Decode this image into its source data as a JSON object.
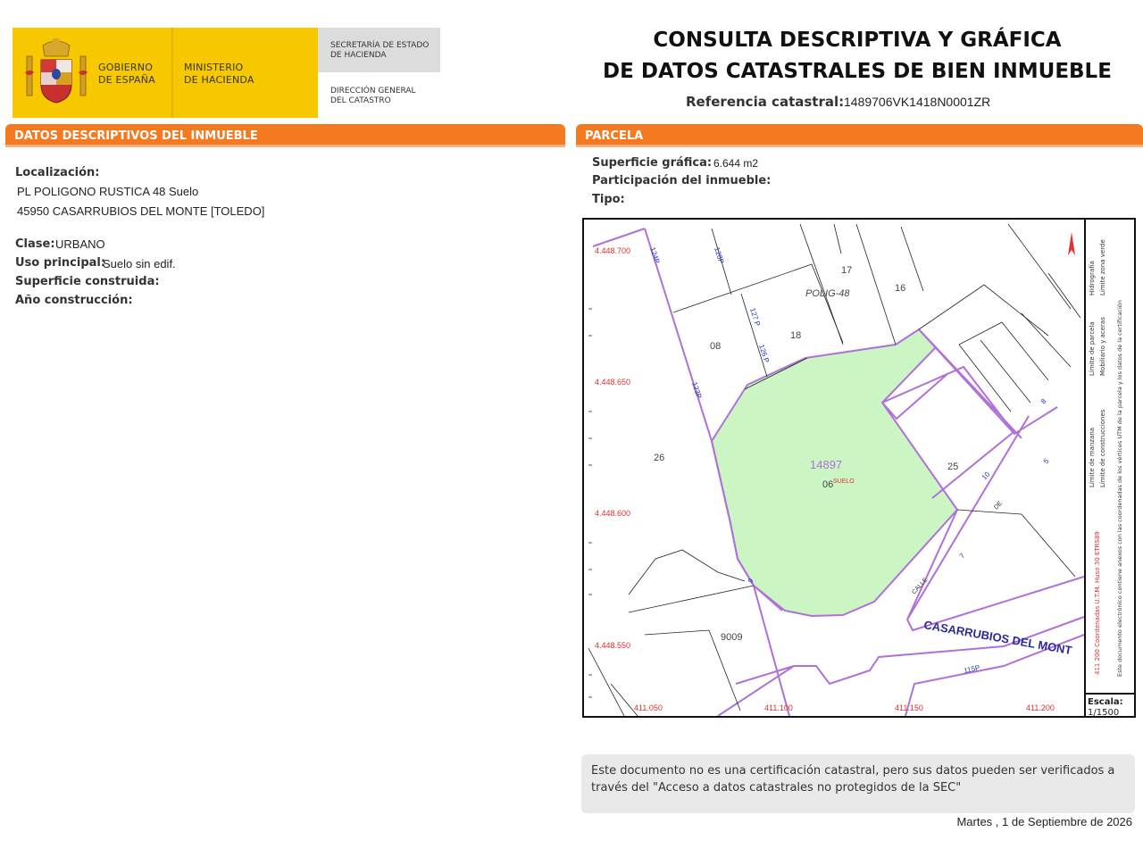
{
  "header": {
    "gobierno": [
      "GOBIERNO",
      "DE ESPAÑA"
    ],
    "ministerio": [
      "MINISTERIO",
      "DE HACIENDA"
    ],
    "secretaria": [
      "SECRETARÍA DE ESTADO",
      "DE HACIENDA"
    ],
    "direccion": [
      "DIRECCIÓN GENERAL",
      "DEL CATASTRO"
    ],
    "title_line1": "CONSULTA DESCRIPTIVA Y GRÁFICA",
    "title_line2": "DE DATOS CATASTRALES DE BIEN INMUEBLE",
    "ref_label": "Referencia catastral:",
    "ref_value": "1489706VK1418N0001ZR"
  },
  "datos": {
    "section_title": "DATOS DESCRIPTIVOS DEL INMUEBLE",
    "localizacion_label": "Localización:",
    "localizacion_line1": "PL POLIGONO RUSTICA 48  Suelo",
    "localizacion_line2": "45950 CASARRUBIOS DEL MONTE [TOLEDO]",
    "clase_label": "Clase:",
    "clase_value": "URBANO",
    "uso_label": "Uso principal:",
    "uso_value": "Suelo sin edif.",
    "superficie_label": "Superficie construida:",
    "anio_label": "Año construcción:"
  },
  "parcela": {
    "section_title": "PARCELA",
    "superficie_label": "Superficie gráfica:",
    "superficie_value": "6.644 m2",
    "participacion_label": "Participación del inmueble:",
    "tipo_label": "Tipo:"
  },
  "map": {
    "y_coords": [
      "4.448.700",
      "4.448.650",
      "4.448.600",
      "4.448.550"
    ],
    "x_coords": [
      "411.050",
      "411.100",
      "411.150",
      "411.200"
    ],
    "parcel_labels": [
      "17",
      "16",
      "18",
      "08",
      "26",
      "25",
      "9009"
    ],
    "polig_label": "POLIG-48",
    "parcel_number": "14897",
    "parcel_sub": "06",
    "suelo_label": "SUELO",
    "road_labels": [
      "124P",
      "128P",
      "127 P",
      "126 P",
      "123P",
      "115P",
      "10",
      "5",
      "7",
      "8",
      "9"
    ],
    "street_words": [
      "DE",
      "CALLE"
    ],
    "street_name": "CASARRUBIOS DEL MONT",
    "escala_label": "Escala:",
    "escala_value": "1/1500",
    "legend_col1": "411 200 Coordenadas U.T.M. Huso 30 ETRS89",
    "legend_col2": "Límite de manzana",
    "legend_col2b": "Límite de parcela",
    "legend_col2c": "Hidrografía",
    "legend_col3": "Límite de construcciones",
    "legend_col3b": "Mobiliario y aceras",
    "legend_col3c": "Límite zona verde",
    "legend_col4": "Este documento electrónico contiene anexos con las coordenadas de los vértices UTM de la parcela y los datos de la certificación",
    "colors": {
      "parcel_fill": "#ccf5c4",
      "boundary": "#c070e0",
      "coord_text": "#e03030",
      "road_text": "#2030c0"
    }
  },
  "footer": {
    "notice_line1": "Este documento no es una certificación catastral, pero sus datos pueden ser verificados a",
    "notice_line2": "través del \"Acceso a datos catastrales no protegidos de la SEC\"",
    "date": "Martes , 1 de Septiembre de 2026"
  }
}
